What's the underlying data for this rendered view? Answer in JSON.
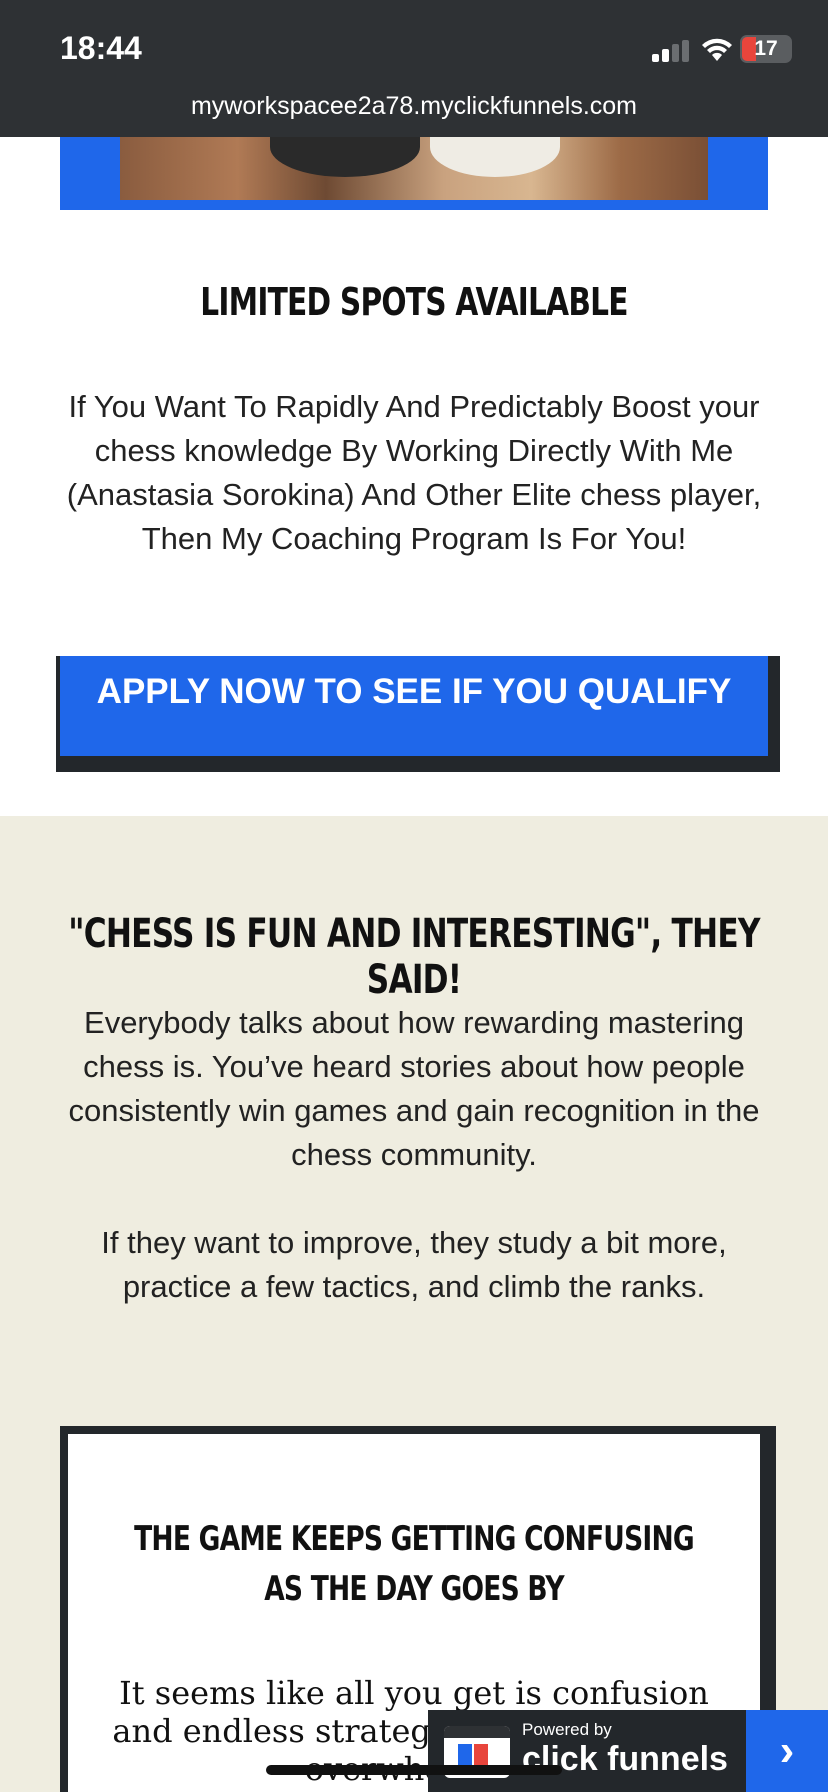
{
  "status_bar": {
    "time": "18:44",
    "battery_level": "17",
    "battery_color": "#e8453c"
  },
  "browser": {
    "url": "myworkspacee2a78.myclickfunnels.com"
  },
  "limited": {
    "heading": "LIMITED SPOTS AVAILABLE",
    "text": "If You Want To Rapidly And Predictably Boost your chess knowledge By Working Directly With Me (Anastasia Sorokina) And Other Elite chess player, Then My Coaching Program Is For You!"
  },
  "cta": {
    "label": "APPLY NOW TO SEE IF YOU QUALIFY",
    "color": "#1f67ea"
  },
  "fun": {
    "heading": "\"CHESS IS FUN AND INTERESTING\", THEY SAID!",
    "paragraphs": [
      "Everybody talks about how rewarding mastering chess is. You’ve heard stories about how people consistently win games and gain recognition in the chess community.",
      "If they want to improve, they study a bit more, practice a few tactics, and climb the ranks."
    ]
  },
  "card": {
    "heading": "THE GAME KEEPS GETTING CONFUSING AS THE DAY GOES BY",
    "text": "It seems like all you get is confusion and endless strategies that leave you overwhelmed"
  },
  "badge": {
    "small": "Powered by",
    "brand": "click funnels",
    "arrow_icon": "chevron-right-icon"
  }
}
